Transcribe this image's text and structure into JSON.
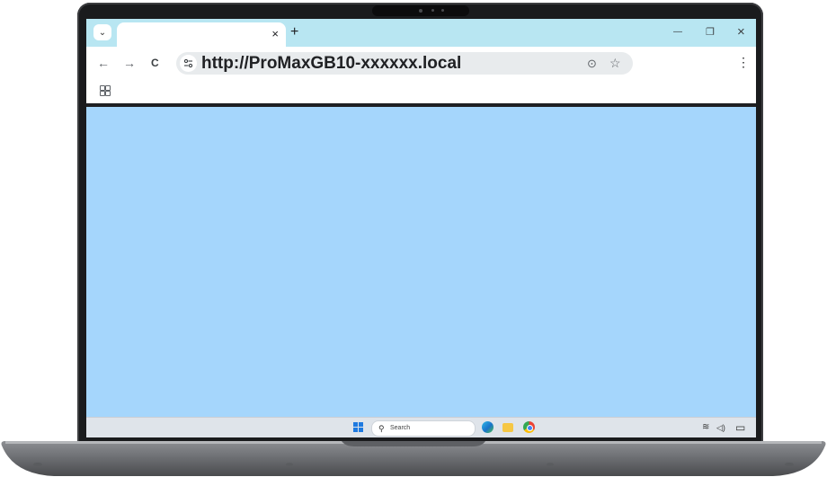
{
  "browser": {
    "tab_search_glyph": "⌄",
    "tab_close_glyph": "×",
    "new_tab_glyph": "+",
    "minimize_glyph": "—",
    "restore_glyph": "❐",
    "close_window_glyph": "×",
    "back_glyph": "←",
    "forward_glyph": "→",
    "reload_glyph": "C",
    "url": "http://ProMaxGB10-xxxxxx.local",
    "location_icon_glyph": "⊙",
    "bookmark_star_glyph": "☆",
    "menu_glyph": "⋮"
  },
  "taskbar": {
    "search_glyph": "⚲",
    "search_placeholder": "Search",
    "wifi_glyph": "≋",
    "volume_glyph": "◁)",
    "battery_glyph": "▭"
  },
  "colors": {
    "tab_strip": "#b8e6f2",
    "page_background": "#a5d6fc",
    "taskbar": "#dfe4ea",
    "windows_blue": "#1f7ae0"
  }
}
